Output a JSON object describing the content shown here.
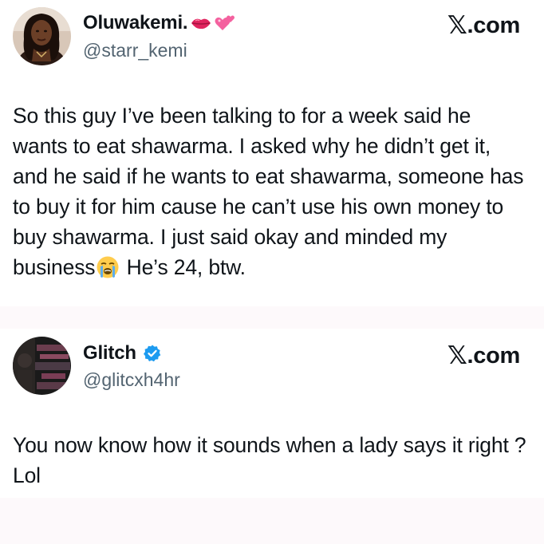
{
  "tweets": [
    {
      "display_name": "Oluwakemi.",
      "handle": "@starr_kemi",
      "brand": ".com",
      "brand_x": "𝕏",
      "name_emojis": [
        "lips-emoji",
        "two-hearts-emoji"
      ],
      "body_part1": "So this guy I’ve been talking to for a week said he wants to eat shawarma. I asked why he didn’t get it, and he said if he wants to eat shawarma, someone has to buy it for him cause he can’t use his own money to buy shawarma. I just said okay and minded my business",
      "body_emoji": "loudly-crying-face-emoji",
      "body_part2": "He’s 24, btw."
    },
    {
      "display_name": "Glitch",
      "handle": "@glitcxh4hr",
      "brand": ".com",
      "brand_x": "𝕏",
      "verified": true,
      "verified_color": "#1d9bf0",
      "body_part1": "You now know how it sounds when a lady says it right ? Lol"
    }
  ],
  "colors": {
    "text": "#0f1419",
    "secondary": "#536471",
    "separator": "#fdf9fb"
  }
}
